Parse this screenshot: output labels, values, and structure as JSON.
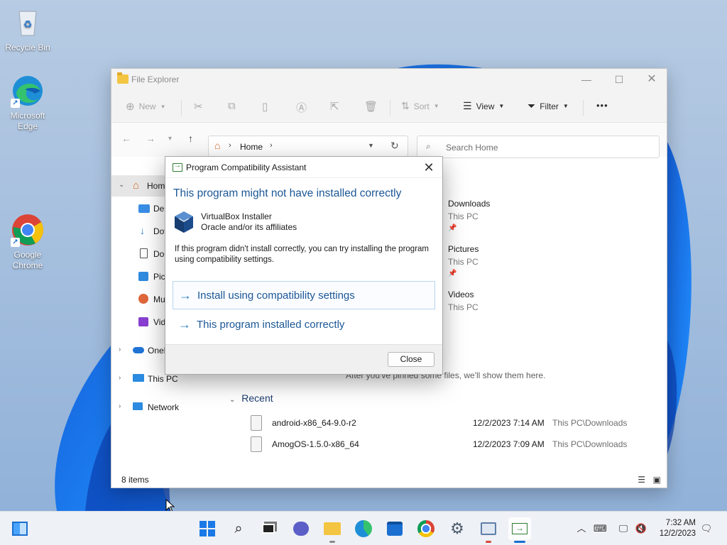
{
  "desktop": {
    "icons": [
      {
        "label": "Recycle Bin"
      },
      {
        "label": "Microsoft Edge"
      },
      {
        "label": "Google Chrome"
      }
    ]
  },
  "explorer": {
    "title": "File Explorer",
    "toolbar": {
      "new_label": "New",
      "sort_label": "Sort",
      "view_label": "View",
      "filter_label": "Filter",
      "more_label": "•••"
    },
    "address": {
      "location": "Home"
    },
    "search": {
      "placeholder": "Search Home"
    },
    "nav": [
      {
        "label": "Home"
      },
      {
        "label": "Des"
      },
      {
        "label": "Dov"
      },
      {
        "label": "Doc"
      },
      {
        "label": "Pict"
      },
      {
        "label": "Mu"
      },
      {
        "label": "Vid"
      },
      {
        "label": "OneD"
      },
      {
        "label": "This PC"
      },
      {
        "label": "Network"
      }
    ],
    "quick_access": [
      {
        "name": "Downloads",
        "location": "This PC"
      },
      {
        "name": "Pictures",
        "location": "This PC"
      },
      {
        "name": "Videos",
        "location": "This PC"
      }
    ],
    "favorites_hint": "After you've pinned some files, we'll show them here.",
    "recent_header": "Recent",
    "recent": [
      {
        "name": "android-x86_64-9.0-r2",
        "date": "12/2/2023 7:14 AM",
        "location": "This PC\\Downloads"
      },
      {
        "name": "AmogOS-1.5.0-x86_64",
        "date": "12/2/2023 7:09 AM",
        "location": "This PC\\Downloads"
      }
    ],
    "status": "8 items"
  },
  "dialog": {
    "title": "Program Compatibility Assistant",
    "heading": "This program might not have installed correctly",
    "app_name": "VirtualBox Installer",
    "publisher": "Oracle and/or its affiliates",
    "message": "If this program didn't install correctly, you can try installing the program using compatibility settings.",
    "option_1": "Install using compatibility settings",
    "option_2": "This program installed correctly",
    "close_button": "Close"
  },
  "taskbar": {
    "time": "7:32 AM",
    "date": "12/2/2023"
  }
}
